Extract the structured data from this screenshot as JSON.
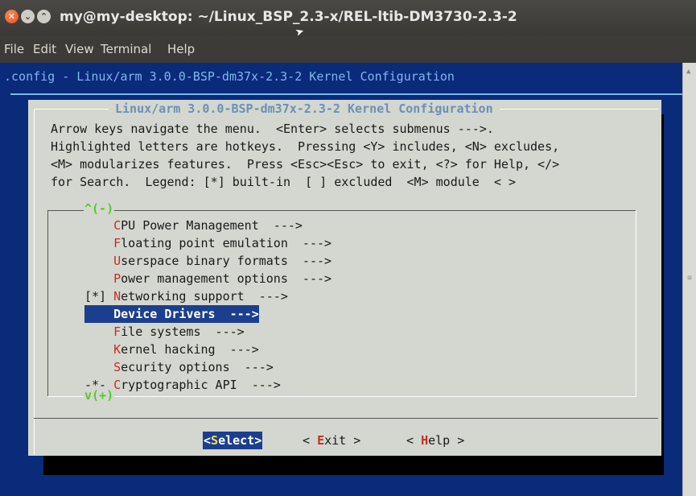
{
  "window": {
    "title": "my@my-desktop: ~/Linux_BSP_2.3-x/REL-ltib-DM3730-2.3-2",
    "close_glyph": "✕",
    "min_glyph": "⌄",
    "max_glyph": "⌃"
  },
  "menubar": {
    "file": "File",
    "edit": "Edit",
    "view": "View",
    "terminal": "Terminal",
    "help": "Help"
  },
  "terminal": {
    "config_title": ".config - Linux/arm 3.0.0-BSP-dm37x-2.3-2 Kernel Configuration"
  },
  "dialog": {
    "title": "Linux/arm 3.0.0-BSP-dm37x-2.3-2 Kernel Configuration",
    "help_lines": [
      "Arrow keys navigate the menu.  <Enter> selects submenus --->.",
      "Highlighted letters are hotkeys.  Pressing <Y> includes, <N> excludes,",
      "<M> modularizes features.  Press <Esc><Esc> to exit, <?> for Help, </>",
      "for Search.  Legend: [*] built-in  [ ] excluded  <M> module  < >"
    ],
    "scroll_up": "^(-)",
    "scroll_down": "v(+)",
    "items": [
      {
        "prefix": "    ",
        "hotkey": "C",
        "rest": "PU Power Management  --->"
      },
      {
        "prefix": "    ",
        "hotkey": "F",
        "rest": "loating point emulation  --->"
      },
      {
        "prefix": "    ",
        "hotkey": "U",
        "rest": "serspace binary formats  --->"
      },
      {
        "prefix": "    ",
        "hotkey": "P",
        "rest": "ower management options  --->"
      },
      {
        "prefix": "[*] ",
        "hotkey": "N",
        "rest": "etworking support  --->"
      },
      {
        "prefix": "    ",
        "hotkey": "D",
        "rest": "evice Drivers  --->"
      },
      {
        "prefix": "    ",
        "hotkey": "F",
        "rest": "ile systems  --->"
      },
      {
        "prefix": "    ",
        "hotkey": "K",
        "rest": "ernel hacking  --->"
      },
      {
        "prefix": "    ",
        "hotkey": "S",
        "rest": "ecurity options  --->"
      },
      {
        "prefix": "-*- ",
        "hotkey": "C",
        "rest": "ryptographic API  --->"
      }
    ],
    "selected_index": 5,
    "buttons": {
      "select": {
        "open": "<",
        "hotkey": "S",
        "rest": "elect",
        "close": ">"
      },
      "exit": {
        "open": "< ",
        "hotkey": "E",
        "rest": "xit",
        "close": " >"
      },
      "help": {
        "open": "< ",
        "hotkey": "H",
        "rest": "elp",
        "close": " >"
      }
    }
  }
}
